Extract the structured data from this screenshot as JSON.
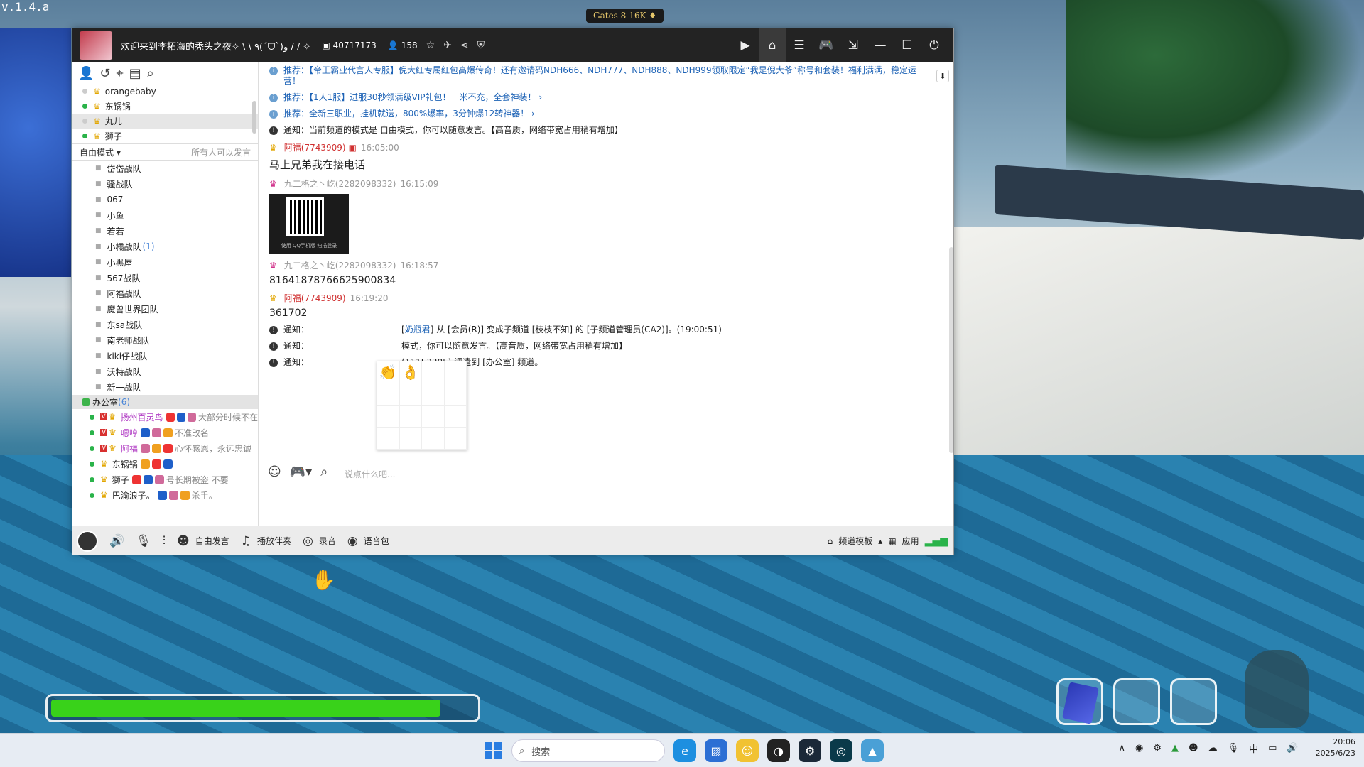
{
  "game": {
    "version": "v.1.4.a",
    "gates_sign": "Gates 8-16K ♦",
    "hp": 0.92
  },
  "window": {
    "title": "欢迎来到李拓海的秃头之夜✧ \\ \\ ٩(ˊᗜˋ)و / / ✧",
    "room_id": "40717173",
    "online": "158",
    "mode_label": "自由模式",
    "mode_hint": "所有人可以发言"
  },
  "users": [
    {
      "name": "orangebaby",
      "online": false
    },
    {
      "name": "东锅锅",
      "online": true
    },
    {
      "name": "丸儿",
      "online": false,
      "selected": true
    },
    {
      "name": "獅子",
      "online": true
    }
  ],
  "channels": [
    {
      "name": "岱岱战队"
    },
    {
      "name": "骚战队"
    },
    {
      "name": "067"
    },
    {
      "name": "小鱼"
    },
    {
      "name": "若若"
    },
    {
      "name": "小橘战队",
      "count": "(1)"
    },
    {
      "name": "小黑屋"
    },
    {
      "name": "567战队"
    },
    {
      "name": "阿福战队"
    },
    {
      "name": "魔兽世界团队"
    },
    {
      "name": "东sa战队"
    },
    {
      "name": "南老师战队"
    },
    {
      "name": "kiki仔战队"
    },
    {
      "name": "沃特战队"
    },
    {
      "name": "新一战队"
    }
  ],
  "current_channel": {
    "name": "办公室",
    "count": "(6)"
  },
  "members": [
    {
      "name": "扬州百灵鸟",
      "sig": "大部分时候不在",
      "purple": true
    },
    {
      "name": "嗯哼",
      "sig": "不准改名",
      "purple": true
    },
    {
      "name": "阿福",
      "sig": "心怀感恩，永远忠诚",
      "purple": true
    },
    {
      "name": "东锅锅",
      "sig": "",
      "purple": false
    },
    {
      "name": "獅子",
      "sig": "号长期被盗 不要",
      "purple": false
    },
    {
      "name": "巴渝浪子。",
      "sig": "杀手。",
      "purple": false
    }
  ],
  "chat": {
    "notices": [
      {
        "kind": "推荐",
        "text": "推荐：【帝王霸业代言人专服】倪大红专属红包高爆传奇！还有邀请码NDH666、NDH777、NDH888、NDH999领取限定“我是倪大爷”称号和套装！福利满满，稳定运营！"
      },
      {
        "kind": "推荐",
        "text": "推荐：【1人1服】进服30秒领满级VIP礼包！一米不充，全套神装！ ›"
      },
      {
        "kind": "推荐",
        "text": "推荐：全新三职业，挂机就送，800%爆率，3分钟爆12转神器！ ›"
      },
      {
        "kind": "通知",
        "text": "通知：当前频道的模式是 自由模式，你可以随意发言。【高音质，网络带宽占用稍有增加】"
      }
    ],
    "msg1": {
      "name": "阿福(7743909)",
      "time": "16:05:00",
      "text": "马上兄弟我在接电话"
    },
    "msg2": {
      "name": "九二格之丶屹(2282098332)",
      "time": "16:15:09",
      "qr_caption": "使用 QQ手机版 扫描登录"
    },
    "msg3": {
      "name": "九二格之丶屹(2282098332)",
      "time": "16:18:57",
      "text": "81641878766625900834"
    },
    "msg4": {
      "name": "阿福(7743909)",
      "time": "16:19:20",
      "text": "361702"
    },
    "n5": {
      "pre": "通知：",
      "link": "奶瓶君",
      "text": "] 从 [会员(R)] 变成子频道 [枝枝不知] 的 [子频道管理员(CA2)]。(19:00:51)"
    },
    "n6": {
      "pre": "通知：",
      "text": "模式，你可以随意发言。【高音质，网络带宽占用稍有增加】"
    },
    "n7": {
      "pre": "通知：",
      "text": "(11153385) 调遣到 [办公室] 频道。"
    }
  },
  "input": {
    "placeholder": "说点什么吧..."
  },
  "bottom": {
    "free_talk": "自由发言",
    "accompany": "播放伴奏",
    "record": "录音",
    "voice_pack": "语音包",
    "template": "频道模板",
    "apps": "应用"
  },
  "taskbar": {
    "search": "搜索",
    "time": "20:06",
    "date": "2025/6/23",
    "ime": "中"
  }
}
